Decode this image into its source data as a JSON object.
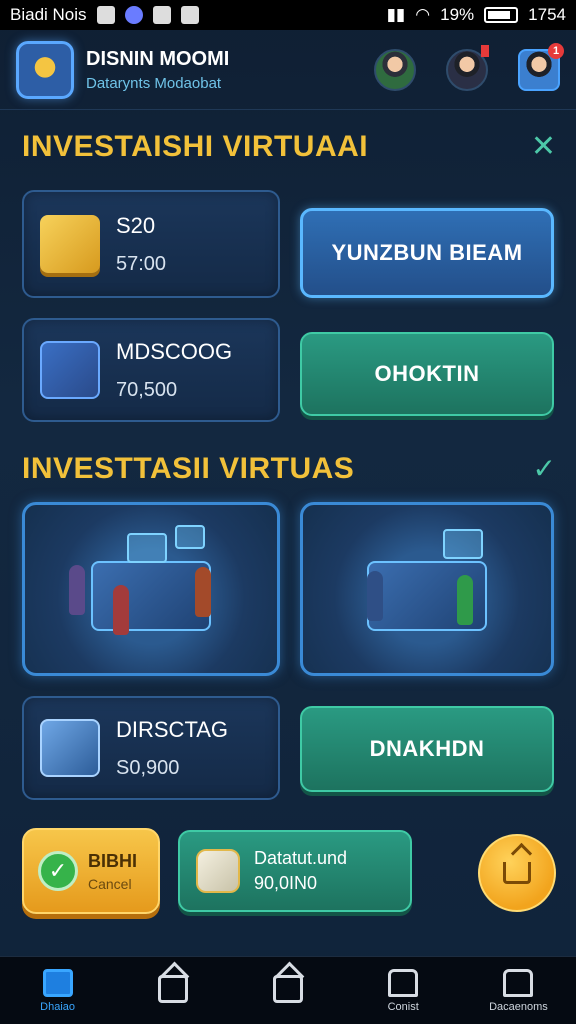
{
  "status_bar": {
    "carrier": "Biadi Nois",
    "battery": "19%",
    "time": "1754"
  },
  "header": {
    "title": "DISNIN MOOMI",
    "subtitle": "Datarynts Modaobat",
    "notification_count": "1"
  },
  "section1": {
    "title": "INVESTAISHI VIRTUAAI",
    "close_symbol": "✕"
  },
  "section2": {
    "title": "INVESTTASII VIRTUAS",
    "check_symbol": "✓"
  },
  "assets": [
    {
      "name": "S20",
      "value": "57:00",
      "icon": "gold-bars-icon"
    },
    {
      "name": "MDSCOOG",
      "value": "70,500",
      "icon": "safe-coins-icon"
    },
    {
      "name": "DIRSCTAG",
      "value": "S0,900",
      "icon": "glass-vault-icon"
    }
  ],
  "buttons": {
    "blue_action": "YUNZBUN BIEAM",
    "green_action_1": "OHOKTIN",
    "green_action_2": "DNAKHDN"
  },
  "confirm": {
    "label": "BIBHI",
    "sublabel": "Cancel"
  },
  "summary": {
    "label": "Datatut.und",
    "value": "90,0IN0"
  },
  "nav": [
    {
      "label": "Dhaiao",
      "icon": "home-icon",
      "active": true
    },
    {
      "label": "",
      "icon": "house-icon",
      "active": false
    },
    {
      "label": "",
      "icon": "pentagon-icon",
      "active": false
    },
    {
      "label": "Conist",
      "icon": "document-icon",
      "active": false
    },
    {
      "label": "Dacaenoms",
      "icon": "bag-icon",
      "active": false
    }
  ],
  "colors": {
    "accent_gold": "#f2c13a",
    "accent_blue": "#5ab8ff",
    "accent_green": "#3fcaa5",
    "background": "#132840"
  }
}
